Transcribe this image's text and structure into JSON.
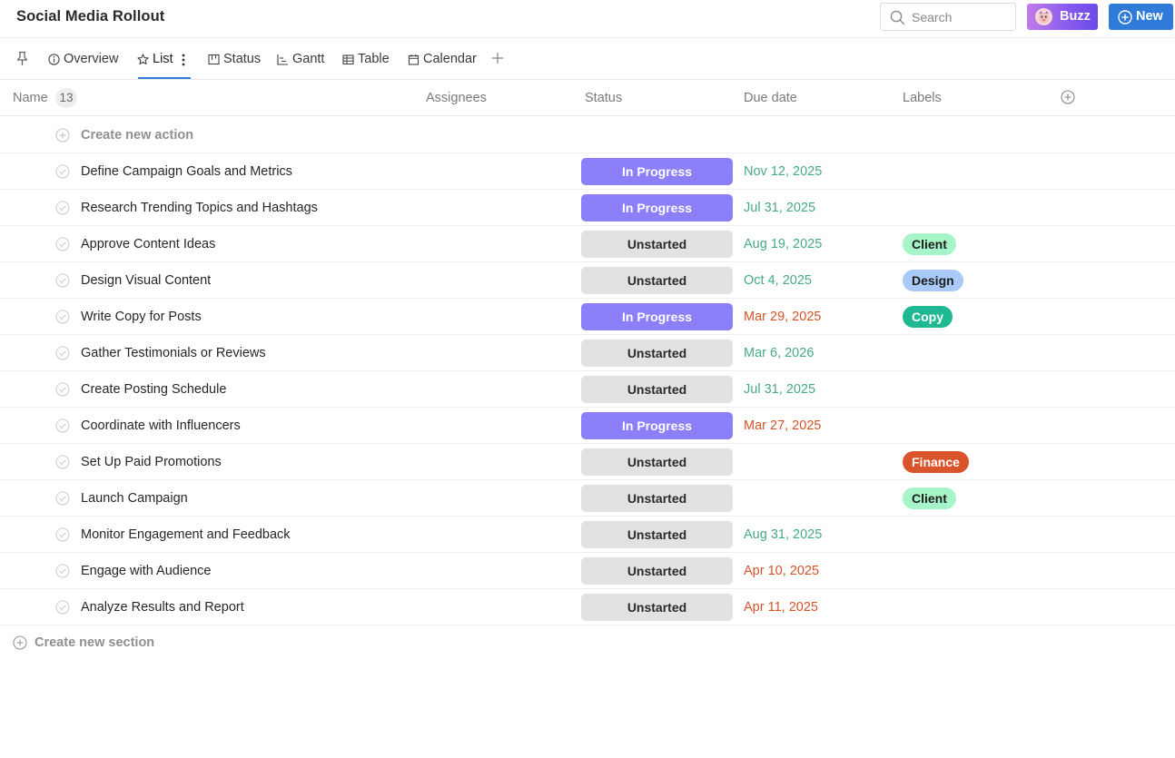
{
  "app": {
    "title": "Social Media Rollout"
  },
  "topbar": {
    "search_placeholder": "Search",
    "buzz_label": "Buzz",
    "new_label": "New"
  },
  "tabs": [
    {
      "label": "Overview",
      "icon": "info-icon"
    },
    {
      "label": "List",
      "icon": "star-icon",
      "active": true
    },
    {
      "label": "Status",
      "icon": "board-icon"
    },
    {
      "label": "Gantt",
      "icon": "gantt-icon"
    },
    {
      "label": "Table",
      "icon": "table-icon"
    },
    {
      "label": "Calendar",
      "icon": "calendar-icon"
    }
  ],
  "header": {
    "name": "Name",
    "count": "13",
    "assignees": "Assignees",
    "status": "Status",
    "due_date": "Due date",
    "labels": "Labels"
  },
  "create_action": "Create new action",
  "create_section": "Create new section",
  "colors": {
    "in_progress": "#8c80f8",
    "unstarted": "#e2e2e2",
    "due_future": "#47a986",
    "due_overdue": "#d4532a",
    "accent": "#2f7bd9"
  },
  "rows": [
    {
      "name": "Define Campaign Goals and Metrics",
      "status": "In Progress",
      "status_type": "inprogress",
      "due": "Nov 12, 2025",
      "due_type": "future",
      "label": ""
    },
    {
      "name": "Research Trending Topics and Hashtags",
      "status": "In Progress",
      "status_type": "inprogress",
      "due": "Jul 31, 2025",
      "due_type": "future",
      "label": ""
    },
    {
      "name": "Approve Content Ideas",
      "status": "Unstarted",
      "status_type": "unstarted",
      "due": "Aug 19, 2025",
      "due_type": "future",
      "label": "Client",
      "label_bg": "#a6f4c8",
      "label_fg": "#1c1c1c"
    },
    {
      "name": "Design Visual Content",
      "status": "Unstarted",
      "status_type": "unstarted",
      "due": "Oct 4, 2025",
      "due_type": "future",
      "label": "Design",
      "label_bg": "#a9c9f8",
      "label_fg": "#1c1c1c"
    },
    {
      "name": "Write Copy for Posts",
      "status": "In Progress",
      "status_type": "inprogress",
      "due": "Mar 29, 2025",
      "due_type": "overdue",
      "label": "Copy",
      "label_bg": "#1fb893",
      "label_fg": "#ffffff"
    },
    {
      "name": "Gather Testimonials or Reviews",
      "status": "Unstarted",
      "status_type": "unstarted",
      "due": "Mar 6, 2026",
      "due_type": "future",
      "label": ""
    },
    {
      "name": "Create Posting Schedule",
      "status": "Unstarted",
      "status_type": "unstarted",
      "due": "Jul 31, 2025",
      "due_type": "future",
      "label": ""
    },
    {
      "name": "Coordinate with Influencers",
      "status": "In Progress",
      "status_type": "inprogress",
      "due": "Mar 27, 2025",
      "due_type": "overdue",
      "label": ""
    },
    {
      "name": "Set Up Paid Promotions",
      "status": "Unstarted",
      "status_type": "unstarted",
      "due": "",
      "due_type": "future",
      "label": "Finance",
      "label_bg": "#d9542a",
      "label_fg": "#ffffff"
    },
    {
      "name": "Launch Campaign",
      "status": "Unstarted",
      "status_type": "unstarted",
      "due": "",
      "due_type": "future",
      "label": "Client",
      "label_bg": "#a6f4c8",
      "label_fg": "#1c1c1c"
    },
    {
      "name": "Monitor Engagement and Feedback",
      "status": "Unstarted",
      "status_type": "unstarted",
      "due": "Aug 31, 2025",
      "due_type": "future",
      "label": ""
    },
    {
      "name": "Engage with Audience",
      "status": "Unstarted",
      "status_type": "unstarted",
      "due": "Apr 10, 2025",
      "due_type": "overdue",
      "label": ""
    },
    {
      "name": "Analyze Results and Report",
      "status": "Unstarted",
      "status_type": "unstarted",
      "due": "Apr 11, 2025",
      "due_type": "overdue",
      "label": ""
    }
  ]
}
